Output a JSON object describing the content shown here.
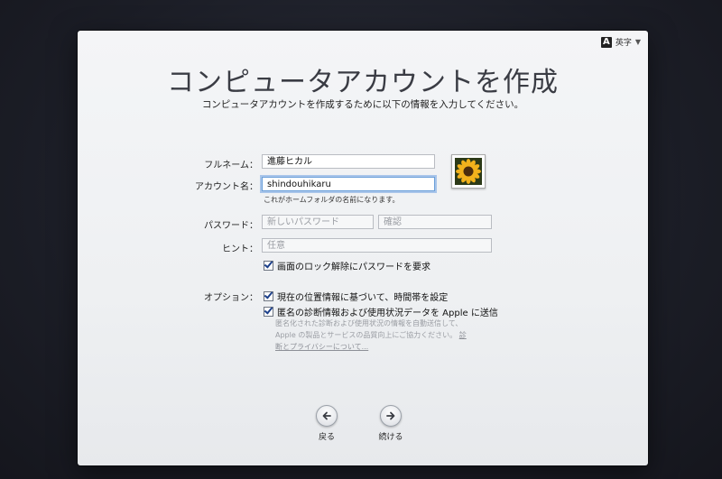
{
  "input_menu": {
    "label": "英字"
  },
  "header": {
    "title": "コンピュータアカウントを作成",
    "subtitle": "コンピュータアカウントを作成するために以下の情報を入力してください。"
  },
  "form": {
    "fullname": {
      "label": "フルネーム：",
      "value": "進藤ヒカル"
    },
    "account": {
      "label": "アカウント名：",
      "value": "shindouhikaru",
      "help": "これがホームフォルダの名前になります。"
    },
    "password": {
      "label": "パスワード：",
      "placeholder": "新しいパスワード",
      "verify_placeholder": "確認"
    },
    "hint": {
      "label": "ヒント：",
      "placeholder": "任意"
    },
    "require_password": {
      "label": "画面のロック解除にパスワードを要求",
      "checked": true
    }
  },
  "options": {
    "label": "オプション：",
    "timezone": {
      "label": "現在の位置情報に基づいて、時間帯を設定",
      "checked": true
    },
    "diagnostics": {
      "label": "匿名の診断情報および使用状況データを Apple に送信",
      "checked": true
    },
    "note_line1": "匿名化された診断および使用状況の情報を自動送信して、",
    "note_line2_pre": "Apple の製品とサービスの品質向上にご協力ください。",
    "note_link_part1": "診",
    "note_link_part2": "断とプライバシーについて..."
  },
  "nav": {
    "back_label": "戻る",
    "continue_label": "続ける"
  },
  "colors": {
    "focus_ring": "#6a9fd9",
    "check": "#1b3f8a"
  }
}
